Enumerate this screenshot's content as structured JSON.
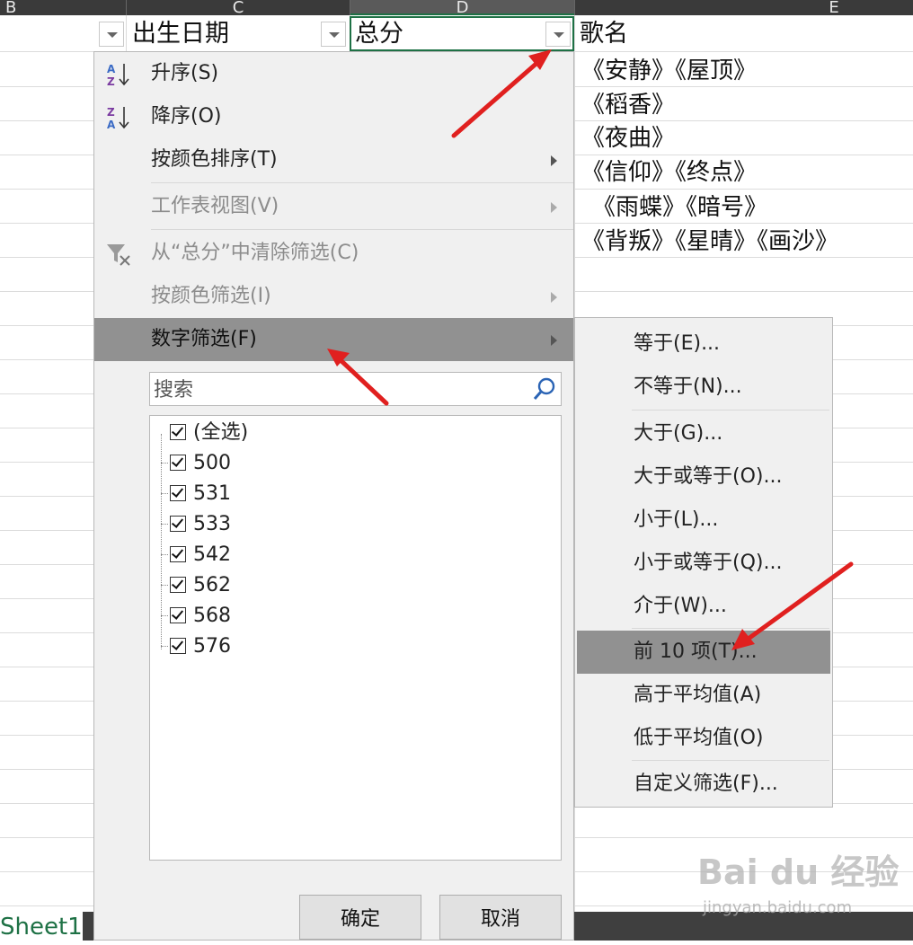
{
  "columns": [
    "B",
    "C",
    "D",
    "E"
  ],
  "headers": {
    "birth_date": "出生日期",
    "total_score": "总分",
    "song_name": "歌名"
  },
  "songs": [
    "《安静》《屋顶》",
    "《稻香》",
    "《夜曲》",
    "《信仰》《终点》",
    "《雨蝶》《暗号》",
    "《背叛》《星晴》《画沙》"
  ],
  "menu": {
    "sort_asc": "升序(S)",
    "sort_desc": "降序(O)",
    "sort_by_color": "按颜色排序(T)",
    "sheet_view": "工作表视图(V)",
    "clear_filter": "从“总分”中清除筛选(C)",
    "filter_by_color": "按颜色筛选(I)",
    "number_filter": "数字筛选(F)"
  },
  "search": {
    "placeholder": "搜索"
  },
  "values": [
    "(全选)",
    "500",
    "531",
    "533",
    "542",
    "562",
    "568",
    "576"
  ],
  "buttons": {
    "ok": "确定",
    "cancel": "取消"
  },
  "submenu": {
    "equals": "等于(E)...",
    "not_equals": "不等于(N)...",
    "greater": "大于(G)...",
    "greater_equal": "大于或等于(O)...",
    "less": "小于(L)...",
    "less_equal": "小于或等于(Q)...",
    "between": "介于(W)...",
    "top10": "前 10 项(T)...",
    "above_avg": "高于平均值(A)",
    "below_avg": "低于平均值(O)",
    "custom": "自定义筛选(F)..."
  },
  "sheet": {
    "tab": "Sheet1"
  },
  "watermark": {
    "line1": "Bai du 经验",
    "line2": "jingyan.baidu.com"
  },
  "colors": {
    "accent": "#1e7145",
    "highlight": "#919191",
    "annotation_arrow": "#e0201f"
  }
}
